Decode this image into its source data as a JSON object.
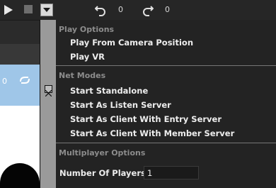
{
  "toolbar": {
    "play_icon": "play-icon",
    "stop_icon": "stop-icon",
    "dropdown_icon": "chevron-down-icon",
    "undo_icon": "undo-icon",
    "redo_icon": "redo-icon",
    "undo_count": "0",
    "redo_count": "0"
  },
  "background": {
    "value": "0",
    "icon": "loop-icon"
  },
  "menu": {
    "play_options_title": "Play Options",
    "play_options_items": [
      "Play From Camera Position",
      "Play VR"
    ],
    "net_modes_title": "Net Modes",
    "net_modes_items": [
      "Start Standalone",
      "Start As Listen Server",
      "Start As Client With Entry Server",
      "Start As Client With Member Server"
    ],
    "multiplayer_title": "Multiplayer Options",
    "players_label": "Number Of Players",
    "players_value": "1"
  },
  "colors": {
    "toolbar_bg": "#262626",
    "menu_bg": "#232323",
    "gutter": "#9a9a9a",
    "viewport_blue": "#9fc6e8"
  }
}
